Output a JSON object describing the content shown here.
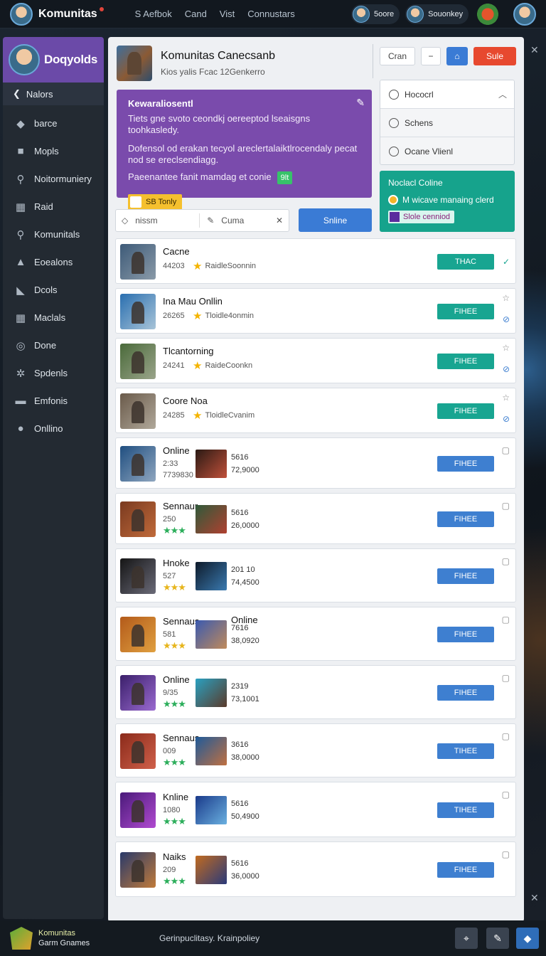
{
  "topbar": {
    "brand": "Komunitas",
    "nav": [
      "S Aefbok",
      "Cand",
      "Vist",
      "Connustars"
    ],
    "chip1": "5oore",
    "chip2": "Souonkey"
  },
  "sidebar": {
    "profile_name": "Doqyolds",
    "back_label": "Nalors",
    "items": [
      {
        "label": "barce",
        "icon": "megaphone-icon",
        "glyph": "◆"
      },
      {
        "label": "Mopls",
        "icon": "gamepad-icon",
        "glyph": "■"
      },
      {
        "label": "Noitormuniery",
        "icon": "search-icon",
        "glyph": "⚲"
      },
      {
        "label": "Raid",
        "icon": "grid-icon",
        "glyph": "▦"
      },
      {
        "label": "Komunitals",
        "icon": "search-icon",
        "glyph": "⚲"
      },
      {
        "label": "Eoealons",
        "icon": "flame-icon",
        "glyph": "▲"
      },
      {
        "label": "Dcols",
        "icon": "shield-icon",
        "glyph": "◣"
      },
      {
        "label": "Maclals",
        "icon": "grid-icon",
        "glyph": "▦"
      },
      {
        "label": "Done",
        "icon": "clock-icon",
        "glyph": "◎"
      },
      {
        "label": "Spdenls",
        "icon": "gear-icon",
        "glyph": "✲"
      },
      {
        "label": "Emfonis",
        "icon": "folder-icon",
        "glyph": "▬"
      },
      {
        "label": "Onllino",
        "icon": "globe-icon",
        "glyph": "●"
      }
    ]
  },
  "header": {
    "title": "Komunitas Canecsanb",
    "subtitle": "Kios yalis Fcac 12Genkerro",
    "btn_cran": "Cran",
    "btn_sule": "Sule"
  },
  "promo": {
    "title": "Kewaraliosentl",
    "line1": "Tiets gne svoto ceondkj oereeptod lseaisgns toohkasledy.",
    "line2": "Dofensol od erakan tecyol areclertalaiktlrocendaly pecat nod se ereclsendiagg.",
    "line3": "Paeenantee fanit mamdag et conie",
    "chip": "9lt",
    "badge": "SB Tonly"
  },
  "dropdown": {
    "options": [
      "Hococrl",
      "Schens",
      "Ocane Vlienl"
    ]
  },
  "status": {
    "title": "Noclacl Coline",
    "line": "M wicave manaing clerd",
    "badge": "Slole cenniod"
  },
  "search": {
    "value": "nissm",
    "filter": "Cuma",
    "button": "Snline"
  },
  "games": [
    {
      "title": "Cacne",
      "num": "44203",
      "meta": "RaidleSoonnin",
      "btn": "THAC",
      "btn_color": "teal",
      "side": "check"
    },
    {
      "title": "Ina Mau Onllin",
      "num": "26265",
      "meta": "Tloidle4onmin",
      "btn": "FIHEE",
      "btn_color": "teal",
      "side": "star"
    },
    {
      "title": "Tlcantorning",
      "num": "24241",
      "meta": "RaideCoonkn",
      "btn": "FIHEE",
      "btn_color": "teal",
      "side": "star"
    },
    {
      "title": "Coore Noa",
      "num": "24285",
      "meta": "TloidleCvanim",
      "btn": "FIHEE",
      "btn_color": "teal",
      "side": "star"
    },
    {
      "title": "Online",
      "num": "2:33",
      "num2": "7739830",
      "stats": [
        "5616",
        "72,9000"
      ],
      "btn": "FIHEE",
      "btn_color": "blue"
    },
    {
      "title": "Sennaur",
      "num": "250",
      "stats": [
        "5616",
        "26,0000"
      ],
      "btn": "FIHEE",
      "btn_color": "blue",
      "rating": "green"
    },
    {
      "title": "Hnoke",
      "num": "527",
      "stats": [
        "201 10",
        "74,4500"
      ],
      "btn": "FIHEE",
      "btn_color": "blue",
      "rating": "yellow"
    },
    {
      "title": "Sennaus",
      "num": "581",
      "title2": "Online",
      "stats": [
        "7616",
        "38,0920"
      ],
      "btn": "FIHEE",
      "btn_color": "blue",
      "rating": "yellow"
    },
    {
      "title": "Online",
      "num": "9/35",
      "stats": [
        "2319",
        "73,1001"
      ],
      "btn": "FIHEE",
      "btn_color": "blue",
      "rating": "green"
    },
    {
      "title": "Sennaus",
      "num": "009",
      "stats": [
        "3616",
        "38,0000"
      ],
      "btn": "TIHEE",
      "btn_color": "blue",
      "rating": "green"
    },
    {
      "title": "Knline",
      "num": "1080",
      "stats": [
        "5616",
        "50,4900"
      ],
      "btn": "TIHEE",
      "btn_color": "blue",
      "rating": "green"
    },
    {
      "title": "Naiks",
      "num": "209",
      "stats": [
        "5616",
        "36,0000"
      ],
      "btn": "FIHEE",
      "btn_color": "blue",
      "rating": "green"
    }
  ],
  "footer": {
    "brand": "Komunitas",
    "sub": "Garm Gnames",
    "center": "Gerinpuclitasy. Krainpoliey"
  },
  "colors": {
    "accent_purple": "#7a4bac",
    "teal": "#18a591",
    "blue": "#3e7fd0",
    "red": "#e7492f"
  }
}
